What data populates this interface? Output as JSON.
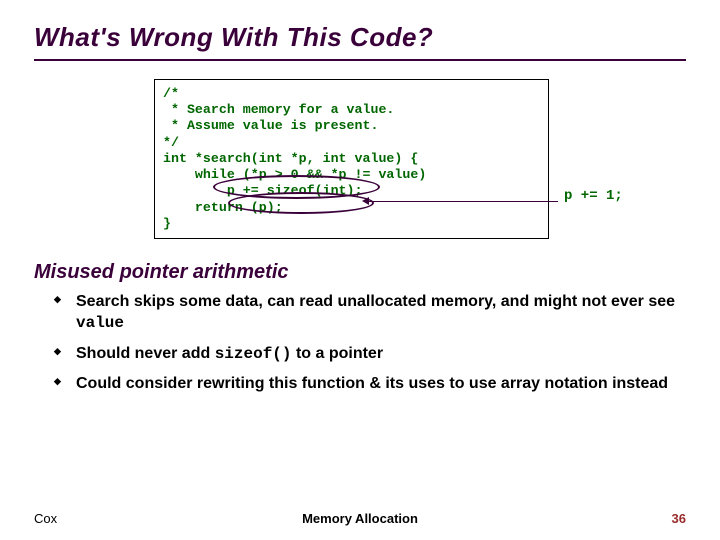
{
  "title": "What's Wrong With This Code?",
  "code": {
    "l1": "/*",
    "l2": " * Search memory for a value.",
    "l3": " * Assume value is present.",
    "l4": "*/",
    "l5": "int *search(int *p, int value) {",
    "l6": "    while (*p > 0 && *p != value)",
    "l7": "        p += sizeof(int);",
    "l8": "    return (p);",
    "l9": "}"
  },
  "annotation": "p += 1;",
  "section": "Misused pointer arithmetic",
  "bullets": {
    "b1a": "Search skips some data, can read unallocated memory, and might not ever see ",
    "b1b": "value",
    "b2a": "Should never add ",
    "b2b": "sizeof()",
    "b2c": " to a pointer",
    "b3": "Could consider rewriting this function & its uses to use array notation instead"
  },
  "footer": {
    "left": "Cox",
    "mid": "Memory Allocation",
    "right": "36"
  }
}
